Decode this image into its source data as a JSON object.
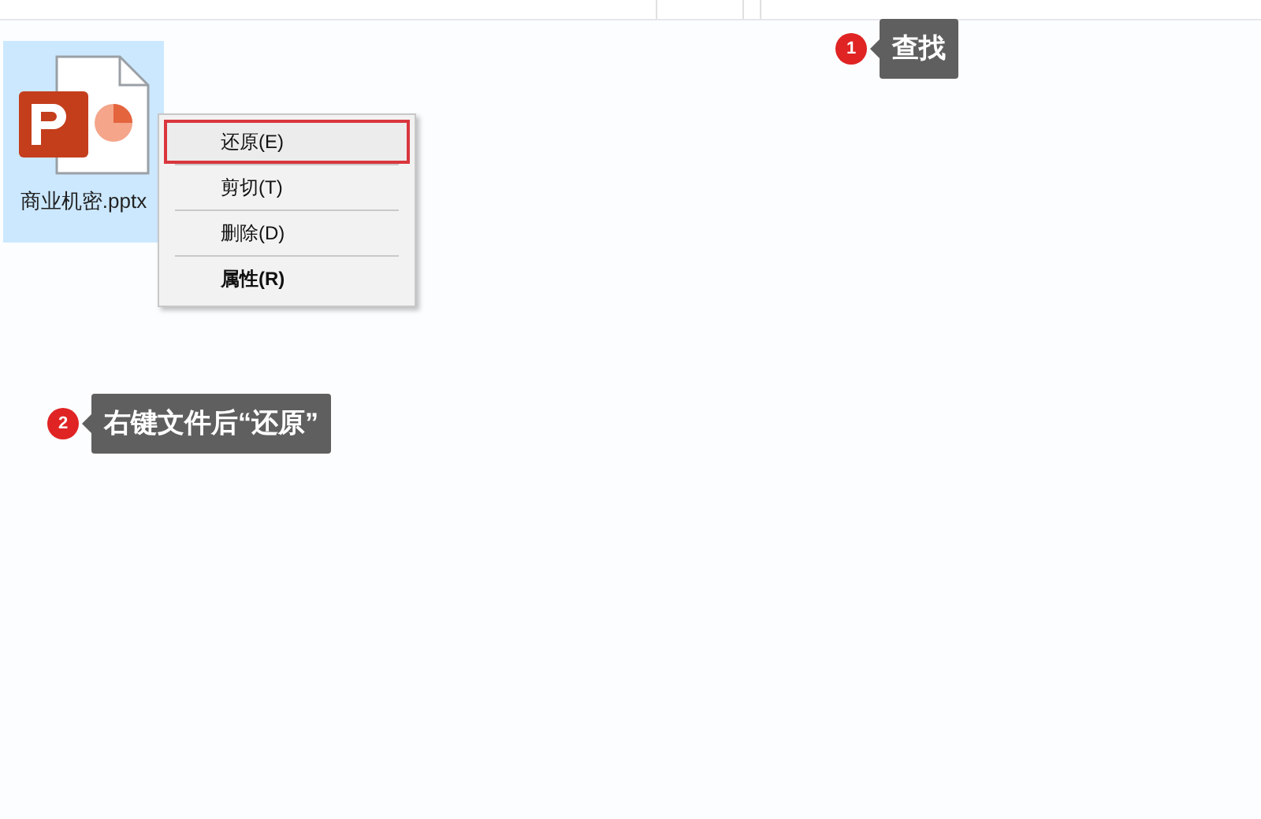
{
  "file": {
    "name": "商业机密.pptx",
    "selected": true
  },
  "context_menu": {
    "items": [
      {
        "label": "还原(E)",
        "highlighted": true,
        "bold": false
      },
      {
        "label": "剪切(T)",
        "highlighted": false,
        "bold": false
      },
      {
        "label": "删除(D)",
        "highlighted": false,
        "bold": false
      },
      {
        "label": "属性(R)",
        "highlighted": false,
        "bold": true
      }
    ]
  },
  "callouts": [
    {
      "number": "1",
      "text": "查找"
    },
    {
      "number": "2",
      "text": "右键文件后“还原”"
    }
  ]
}
